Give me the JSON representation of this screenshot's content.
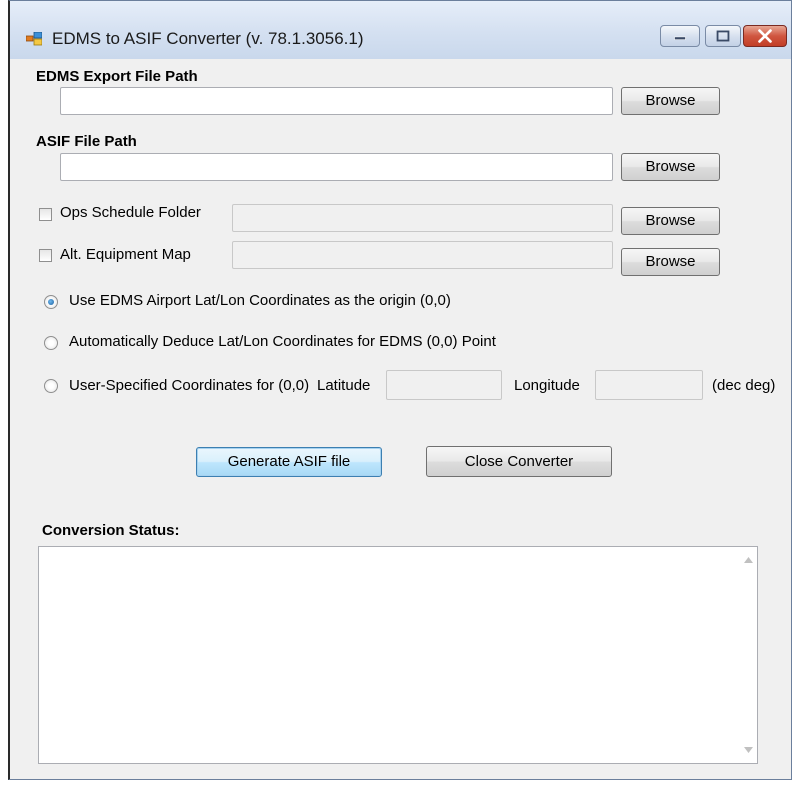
{
  "window": {
    "title": "EDMS to ASIF Converter (v. 78.1.3056.1)"
  },
  "edms_export": {
    "label": "EDMS Export File Path",
    "value": "",
    "browse_label": "Browse"
  },
  "asif_path": {
    "label": "ASIF File Path",
    "value": "",
    "browse_label": "Browse"
  },
  "ops_schedule": {
    "label": "Ops Schedule Folder",
    "checked": false,
    "value": "",
    "browse_label": "Browse"
  },
  "alt_equipment": {
    "label": "Alt. Equipment Map",
    "checked": false,
    "value": "",
    "browse_label": "Browse"
  },
  "origin_options": {
    "selected_index": 0,
    "option_1": "Use EDMS Airport Lat/Lon Coordinates as the origin (0,0)",
    "option_2": "Automatically Deduce Lat/Lon Coordinates for EDMS (0,0) Point",
    "option_3": "User-Specified Coordinates for (0,0)",
    "latitude_label": "Latitude",
    "longitude_label": "Longitude",
    "units_label": "(dec deg)",
    "latitude_value": "",
    "longitude_value": ""
  },
  "actions": {
    "generate_label": "Generate ASIF file",
    "close_label": "Close Converter"
  },
  "status": {
    "label": "Conversion Status:",
    "text": ""
  },
  "colors": {
    "client_bg": "#f0f0f0",
    "close_button": "#c23e26",
    "radio_selected": "#1a5f9e"
  },
  "icons": [
    "app-icon",
    "minimize-icon",
    "maximize-icon",
    "close-icon",
    "scroll-up-arrow-icon",
    "scroll-down-arrow-icon"
  ]
}
